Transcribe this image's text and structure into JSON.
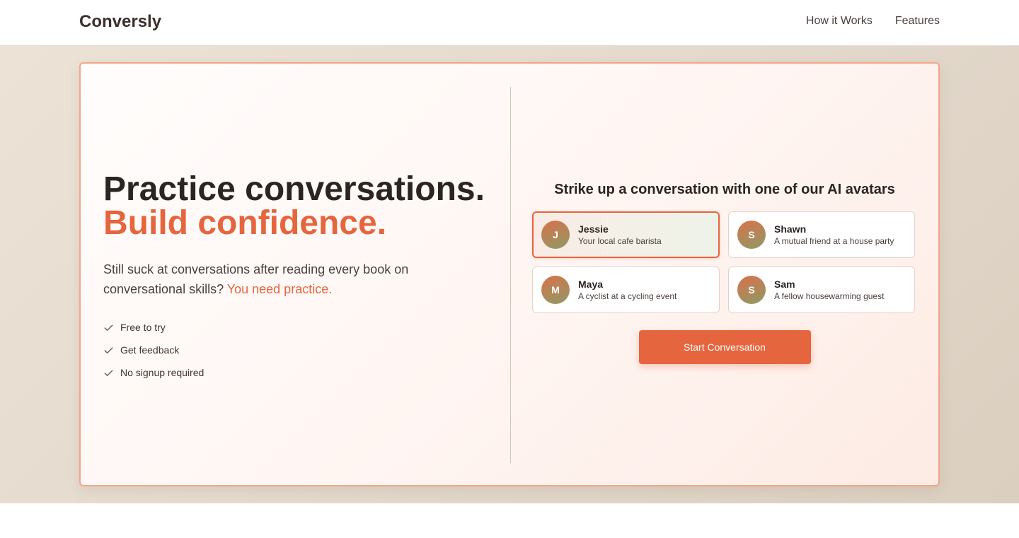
{
  "header": {
    "brand": "Conversly",
    "nav": [
      "How it Works",
      "Features"
    ]
  },
  "hero": {
    "headline_line1": "Practice conversations.",
    "headline_line2": "Build confidence.",
    "subtitle_main": "Still suck at conversations after reading every book on conversational skills?",
    "subtitle_accent": "You need practice.",
    "features": [
      "Free to try",
      "Get feedback",
      "No signup required"
    ]
  },
  "picker": {
    "title": "Strike up a conversation with one of our AI avatars",
    "avatars": [
      {
        "initial": "J",
        "name": "Jessie",
        "description": "Your local cafe barista",
        "selected": true
      },
      {
        "initial": "S",
        "name": "Shawn",
        "description": "A mutual friend at a house party",
        "selected": false
      },
      {
        "initial": "M",
        "name": "Maya",
        "description": "A cyclist at a cycling event",
        "selected": false
      },
      {
        "initial": "S",
        "name": "Sam",
        "description": "A fellow housewarming guest",
        "selected": false
      }
    ],
    "start_label": "Start Conversation"
  },
  "colors": {
    "accent": "#e5653e",
    "text_dark": "#2b2522",
    "card_border": "#f3a58a"
  },
  "icons": {
    "feature_check": "check-icon"
  }
}
